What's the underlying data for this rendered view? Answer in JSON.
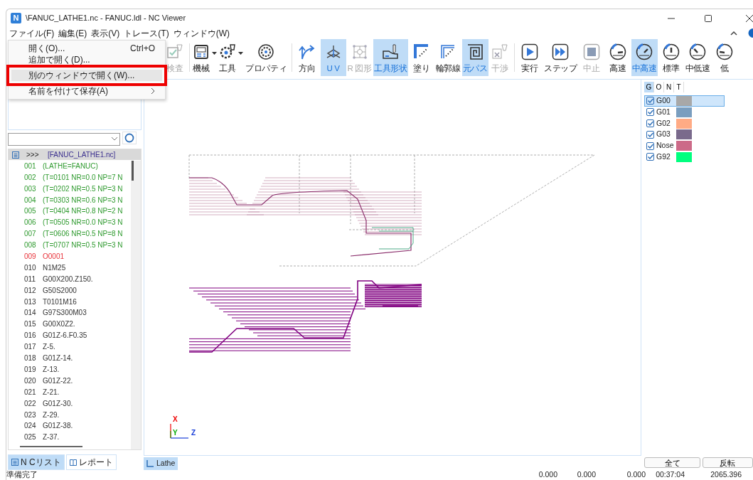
{
  "window": {
    "title": "\\FANUC_LATHE1.nc - FANUC.ldl - NC Viewer",
    "app_icon": "N"
  },
  "menu_bar": [
    "ファイル(F)",
    "編集(E)",
    "表示(V)",
    "トレース(T)",
    "ウィンドウ(W)"
  ],
  "file_menu": [
    {
      "label": "開く(O)...",
      "shortcut": "Ctrl+O",
      "highlighted": false,
      "submenu": false
    },
    {
      "label": "追加で開く(D)...",
      "highlighted": false,
      "submenu": false
    },
    {
      "label": "別のウィンドウで開く(W)...",
      "highlighted": true,
      "submenu": false
    },
    {
      "label": "名前を付けて保存(A)",
      "highlighted": false,
      "submenu": true
    }
  ],
  "toolbar": [
    {
      "label": "検査",
      "disabled": true,
      "selected": false,
      "dropdown": false,
      "group_end": true
    },
    {
      "label": "機械",
      "disabled": false,
      "selected": false,
      "dropdown": true,
      "group_end": false
    },
    {
      "label": "工具",
      "disabled": false,
      "selected": false,
      "dropdown": true,
      "group_end": false
    },
    {
      "label": "プロパティ",
      "disabled": false,
      "selected": false,
      "dropdown": false,
      "group_end": true
    },
    {
      "label": "方向",
      "disabled": false,
      "selected": false,
      "dropdown": false,
      "group_end": false
    },
    {
      "label": "U V",
      "disabled": false,
      "selected": true,
      "dropdown": false,
      "group_end": false
    },
    {
      "label": "R 図形",
      "disabled": true,
      "selected": false,
      "dropdown": false,
      "group_end": false
    },
    {
      "label": "工具形状",
      "disabled": false,
      "selected": true,
      "dropdown": false,
      "group_end": false
    },
    {
      "label": "塗り",
      "disabled": false,
      "selected": false,
      "dropdown": false,
      "group_end": false
    },
    {
      "label": "輪郭線",
      "disabled": false,
      "selected": false,
      "dropdown": false,
      "group_end": false
    },
    {
      "label": "元パス",
      "disabled": false,
      "selected": true,
      "dropdown": false,
      "group_end": false
    },
    {
      "label": "干渉",
      "disabled": true,
      "selected": false,
      "dropdown": false,
      "group_end": true
    },
    {
      "label": "実行",
      "disabled": false,
      "selected": false,
      "dropdown": false,
      "group_end": false
    },
    {
      "label": "ステップ",
      "disabled": false,
      "selected": false,
      "dropdown": false,
      "group_end": false
    },
    {
      "label": "中止",
      "disabled": true,
      "selected": false,
      "dropdown": false,
      "group_end": false
    },
    {
      "label": "高速",
      "disabled": false,
      "selected": false,
      "dropdown": false,
      "group_end": false
    },
    {
      "label": "中高速",
      "disabled": false,
      "selected": true,
      "dropdown": false,
      "group_end": false
    },
    {
      "label": "標準",
      "disabled": false,
      "selected": false,
      "dropdown": false,
      "group_end": false
    },
    {
      "label": "中低速",
      "disabled": false,
      "selected": false,
      "dropdown": false,
      "group_end": false
    },
    {
      "label": "低",
      "disabled": false,
      "selected": false,
      "dropdown": false,
      "group_end": false
    }
  ],
  "nc_list": {
    "header": {
      "marker": ">>>",
      "file": "[FANUC_LATHE1.nc]"
    },
    "rows": [
      {
        "no": "001",
        "code": "(LATHE=FANUC)",
        "kind": "comment"
      },
      {
        "no": "002",
        "code": "(T=0101 NR=0.0 NP=7 N",
        "kind": "comment"
      },
      {
        "no": "003",
        "code": "(T=0202 NR=0.5 NP=3 N",
        "kind": "comment"
      },
      {
        "no": "004",
        "code": "(T=0303 NR=0.6 NP=3 N",
        "kind": "comment"
      },
      {
        "no": "005",
        "code": "(T=0404 NR=0.8 NP=2 N",
        "kind": "comment"
      },
      {
        "no": "006",
        "code": "(T=0505 NR=0.0 NP=3 N",
        "kind": "comment"
      },
      {
        "no": "007",
        "code": "(T=0606 NR=0.5 NP=8 N",
        "kind": "comment"
      },
      {
        "no": "008",
        "code": "(T=0707 NR=0.5 NP=3 N",
        "kind": "comment"
      },
      {
        "no": "009",
        "code": "O0001",
        "kind": "program"
      },
      {
        "no": "010",
        "code": "N1M25",
        "kind": "code"
      },
      {
        "no": "011",
        "code": "G00X200.Z150.",
        "kind": "code"
      },
      {
        "no": "012",
        "code": "G50S2000",
        "kind": "code"
      },
      {
        "no": "013",
        "code": "T0101M16",
        "kind": "code"
      },
      {
        "no": "014",
        "code": "G97S300M03",
        "kind": "code"
      },
      {
        "no": "015",
        "code": "G00X0Z2.",
        "kind": "code"
      },
      {
        "no": "016",
        "code": "G01Z-6.F0.35",
        "kind": "code"
      },
      {
        "no": "017",
        "code": "Z-5.",
        "kind": "code"
      },
      {
        "no": "018",
        "code": "G01Z-14.",
        "kind": "code"
      },
      {
        "no": "019",
        "code": "Z-13.",
        "kind": "code"
      },
      {
        "no": "020",
        "code": "G01Z-22.",
        "kind": "code"
      },
      {
        "no": "021",
        "code": "Z-21.",
        "kind": "code"
      },
      {
        "no": "022",
        "code": "G01Z-30.",
        "kind": "code"
      },
      {
        "no": "023",
        "code": "Z-29.",
        "kind": "code"
      },
      {
        "no": "024",
        "code": "G01Z-38.",
        "kind": "code"
      },
      {
        "no": "025",
        "code": "Z-37.",
        "kind": "code"
      }
    ]
  },
  "left_tabs": [
    {
      "label": "N Cリスト",
      "selected": true
    },
    {
      "label": "レポート",
      "selected": false
    }
  ],
  "view": {
    "axes": [
      "X",
      "Y",
      "Z"
    ],
    "tab": "Lathe"
  },
  "right_panel": {
    "tabs": [
      {
        "label": "G",
        "selected": true
      },
      {
        "label": "O",
        "selected": false
      },
      {
        "label": "N",
        "selected": false
      },
      {
        "label": "T",
        "selected": false
      }
    ],
    "items": [
      {
        "label": "G00",
        "checked": true,
        "selected": true,
        "color": "#a8a8a8"
      },
      {
        "label": "G01",
        "checked": true,
        "selected": false,
        "color": "#7a9ebf"
      },
      {
        "label": "G02",
        "checked": true,
        "selected": false,
        "color": "#ffab85"
      },
      {
        "label": "G03",
        "checked": true,
        "selected": false,
        "color": "#7a6a8c"
      },
      {
        "label": "Nose",
        "checked": true,
        "selected": false,
        "color": "#cc6a88"
      },
      {
        "label": "G92",
        "checked": true,
        "selected": false,
        "color": "#00ff7f"
      }
    ],
    "buttons": [
      "全て",
      "反転"
    ]
  },
  "status_bar": {
    "message": "準備完了",
    "values": [
      "0.000",
      "0.000",
      "0.000",
      "00:37:04",
      "2065.396"
    ]
  }
}
